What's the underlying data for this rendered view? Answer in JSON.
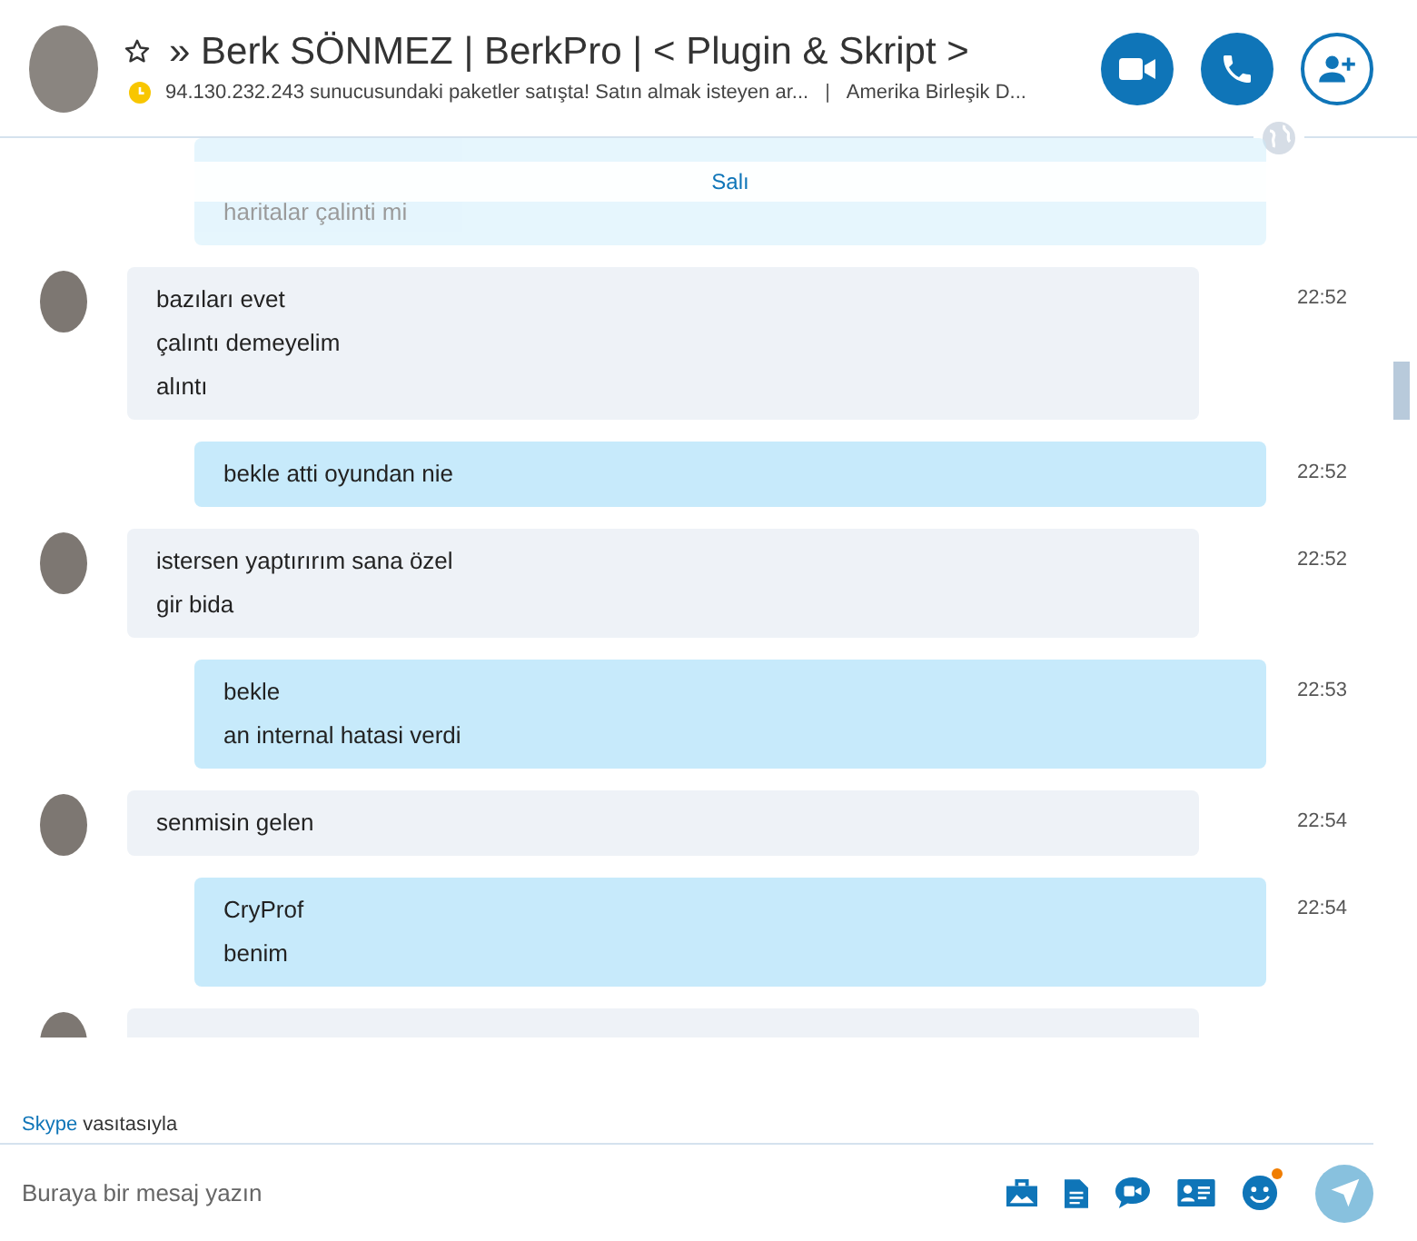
{
  "header": {
    "title": "» Berk SÖNMEZ | BerkPro | < Plugin & Skript >",
    "favorite": false,
    "mood": "94.130.232.243 sunucusundaki paketler satışta! Satın almak isteyen ar...",
    "separator": "|",
    "location": "Amerika Birleşik D..."
  },
  "date_divider": "Salı",
  "messages": [
    {
      "kind": "outgoing",
      "faded": true,
      "lines": [
        "haritalar çalinti mi"
      ]
    },
    {
      "kind": "incoming",
      "faded": false,
      "lines": [
        "bazıları evet",
        "çalıntı demeyelim",
        "alıntı"
      ],
      "time": "22:52"
    },
    {
      "kind": "outgoing",
      "faded": false,
      "lines": [
        "bekle atti oyundan nie"
      ],
      "time": "22:52"
    },
    {
      "kind": "incoming",
      "faded": false,
      "lines": [
        "istersen yaptırırım sana özel",
        "gir bida"
      ],
      "time": "22:52"
    },
    {
      "kind": "outgoing",
      "faded": false,
      "lines": [
        "bekle",
        "an internal hatasi verdi"
      ],
      "time": "22:53"
    },
    {
      "kind": "incoming",
      "faded": false,
      "lines": [
        "senmisin gelen"
      ],
      "time": "22:54"
    },
    {
      "kind": "outgoing",
      "faded": false,
      "lines": [
        "CryProf",
        "benim"
      ],
      "time": "22:54"
    },
    {
      "kind": "incoming",
      "faded": false
    }
  ],
  "via": {
    "link": "Skype",
    "text": "vasıtasıyla"
  },
  "composer": {
    "placeholder": "Buraya bir mesaj yazın",
    "emoji_notification": true
  }
}
